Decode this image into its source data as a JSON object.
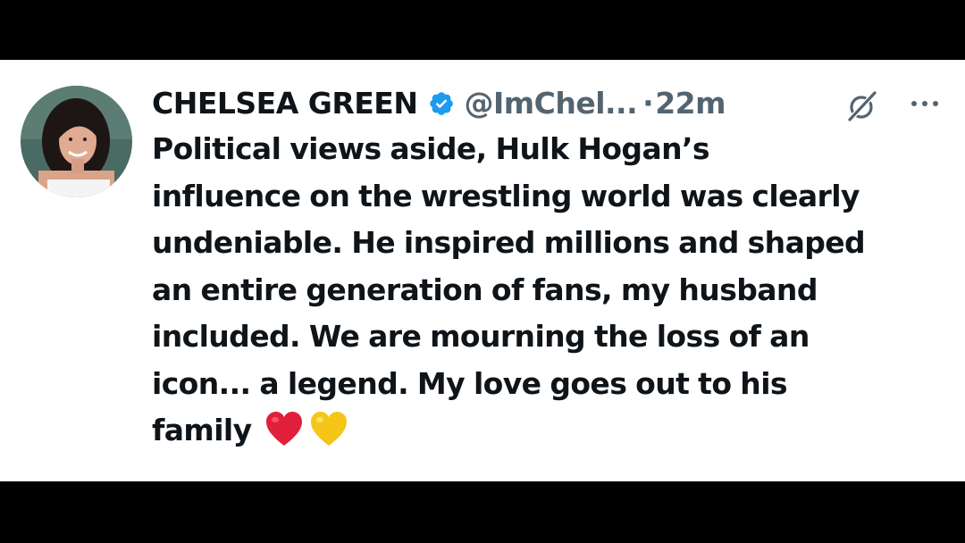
{
  "tweet": {
    "display_name": "CHELSEA GREEN",
    "handle": "@ImChel...",
    "separator": "·",
    "timestamp": "22m",
    "text_lines": [
      "Political views aside, Hulk Hogan’s",
      "influence on the wrestling world was clearly",
      "undeniable. He inspired millions and shaped",
      "an entire generation of fans, my husband",
      "included. We are mourning the loss of an",
      "icon... a legend. My love goes out to his",
      "family"
    ],
    "emojis": [
      "red-heart",
      "yellow-heart"
    ]
  },
  "icons": {
    "verified": "verified-badge-icon",
    "grok": "grok-icon",
    "more": "more-options-icon"
  },
  "colors": {
    "verified_blue": "#1d9bf0",
    "name_text": "#0f1419",
    "secondary_text": "#536471",
    "heart_red": "#e0203a",
    "heart_yellow": "#f5c518"
  }
}
